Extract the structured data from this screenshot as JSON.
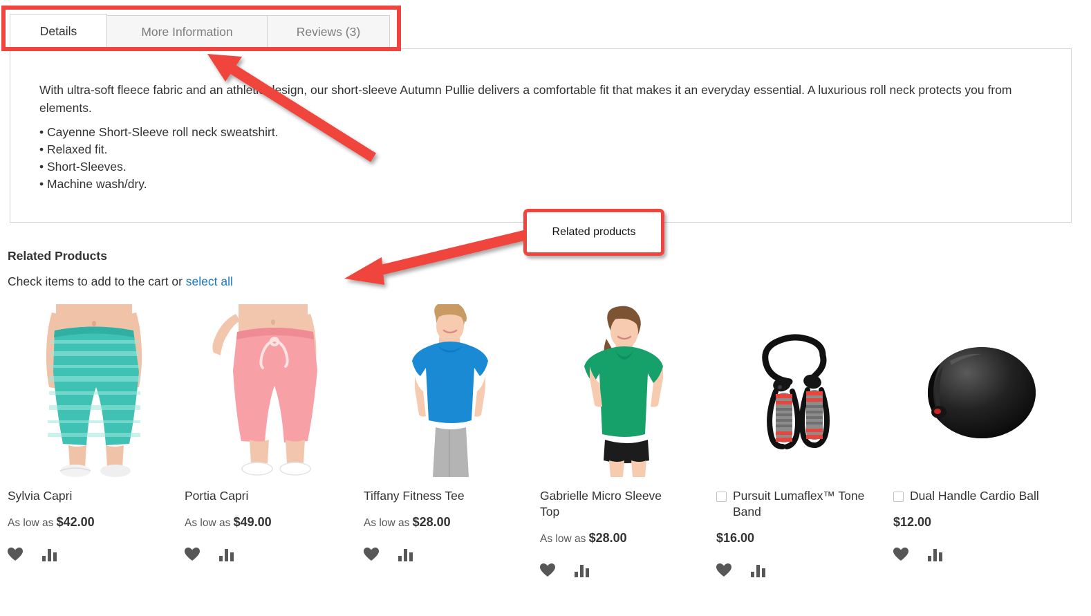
{
  "tabs": [
    {
      "label": "Details",
      "active": true
    },
    {
      "label": "More Information",
      "active": false
    },
    {
      "label": "Reviews (3)",
      "active": false
    }
  ],
  "details": {
    "paragraph": "With ultra-soft fleece fabric and an athletic design, our short-sleeve Autumn Pullie delivers a comfortable fit that makes it an everyday essential. A luxurious roll neck protects you from elements.",
    "bullets": [
      "• Cayenne Short-Sleeve roll neck sweatshirt.",
      "• Relaxed fit.",
      "• Short-Sleeves.",
      "• Machine wash/dry."
    ]
  },
  "related": {
    "heading": "Related Products",
    "instruction_prefix": "Check items to add to the cart or ",
    "select_all_label": "select all",
    "products": [
      {
        "name": "Sylvia Capri",
        "price_prefix": "As low as ",
        "price": "$42.00",
        "has_checkbox": false,
        "image": "teal-striped-capri-leggings",
        "wishlist_icon": "heart-icon",
        "compare_icon": "compare-bars-icon"
      },
      {
        "name": "Portia Capri",
        "price_prefix": "As low as ",
        "price": "$49.00",
        "has_checkbox": false,
        "image": "pink-capri-sweatpants",
        "wishlist_icon": "heart-icon",
        "compare_icon": "compare-bars-icon"
      },
      {
        "name": "Tiffany Fitness Tee",
        "price_prefix": "As low as ",
        "price": "$28.00",
        "has_checkbox": false,
        "image": "blue-scoop-neck-tee",
        "wishlist_icon": "heart-icon",
        "compare_icon": "compare-bars-icon"
      },
      {
        "name": "Gabrielle Micro Sleeve Top",
        "price_prefix": "As low as ",
        "price": "$28.00",
        "has_checkbox": false,
        "image": "green-v-neck-tee",
        "wishlist_icon": "heart-icon",
        "compare_icon": "compare-bars-icon"
      },
      {
        "name": "Pursuit Lumaflex™ Tone Band",
        "price_prefix": "",
        "price": "$16.00",
        "has_checkbox": true,
        "image": "black-resistance-tone-band",
        "wishlist_icon": "heart-icon",
        "compare_icon": "compare-bars-icon"
      },
      {
        "name": "Dual Handle Cardio Ball",
        "price_prefix": "",
        "price": "$12.00",
        "has_checkbox": true,
        "image": "black-cardio-ball",
        "wishlist_icon": "heart-icon",
        "compare_icon": "compare-bars-icon"
      }
    ]
  },
  "annotations": {
    "tabs_box_color": "#f0443e",
    "callout_label": "Related products",
    "callout_border_color": "#f0443e",
    "arrow_color": "#f0443e"
  },
  "colors": {
    "link": "#1979c3",
    "text": "#333333",
    "muted": "#7d7d7d",
    "border": "#d1d1d1",
    "tab_inactive_bg": "#f6f6f6"
  }
}
